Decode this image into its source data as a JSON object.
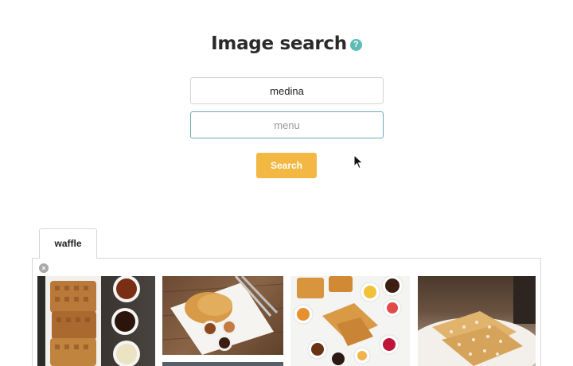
{
  "header": {
    "title": "Image search",
    "help_icon": "question-circle-icon",
    "help_glyph": "?"
  },
  "search": {
    "location_value": "medina",
    "query_placeholder": "menu",
    "button_label": "Search"
  },
  "results": {
    "tabs": [
      {
        "label": "waffle"
      }
    ],
    "close_glyph": "×",
    "images": [
      {
        "name": "waffles-on-tray-with-sauces"
      },
      {
        "name": "waffles-on-plate-with-dips"
      },
      {
        "name": "waffles-with-toppings-overhead"
      },
      {
        "name": "waffles-on-plate-closeup"
      }
    ]
  },
  "colors": {
    "accent_button": "#f3b843",
    "help_icon": "#5dbdb3",
    "focus_border": "#6fa8b8"
  }
}
